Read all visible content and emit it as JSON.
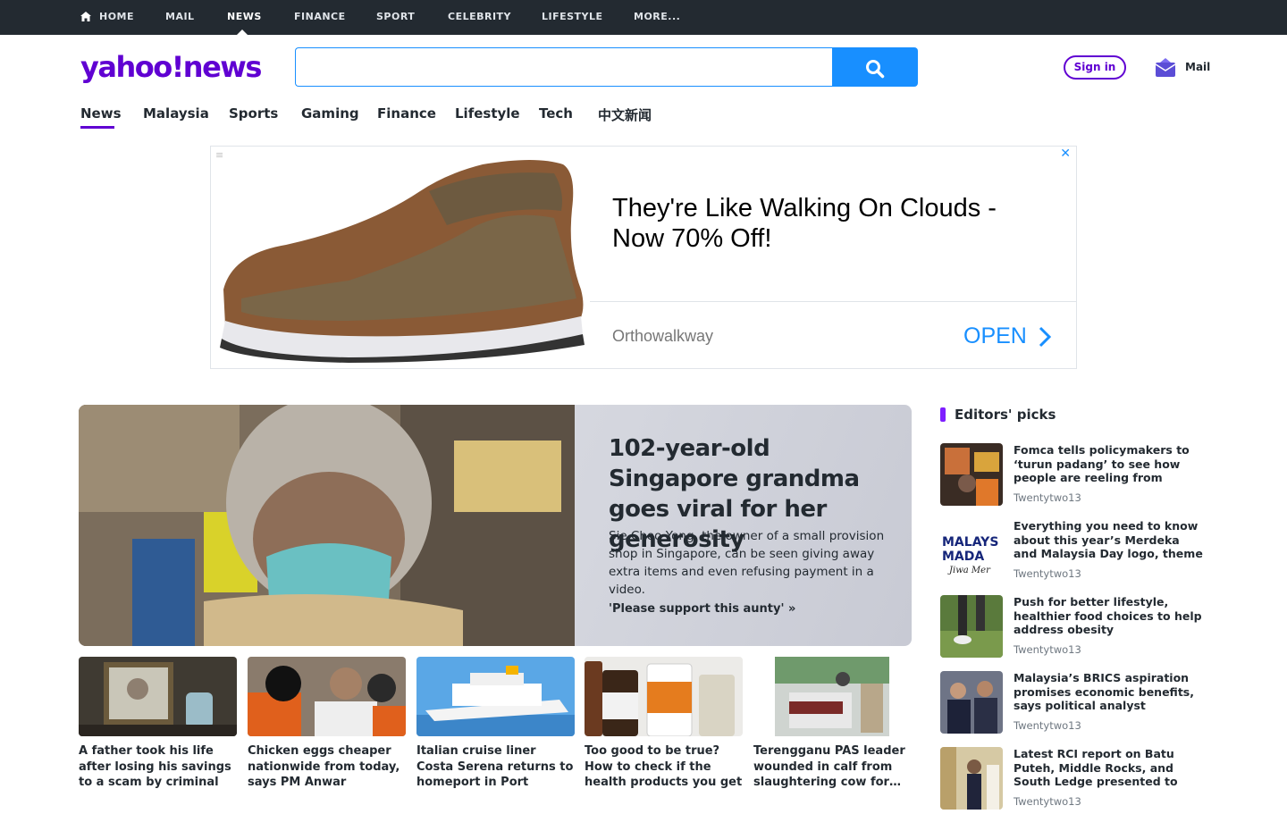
{
  "top_nav": {
    "items": [
      "Home",
      "Mail",
      "News",
      "Finance",
      "Sport",
      "Celebrity",
      "Lifestyle",
      "More..."
    ],
    "active": "News"
  },
  "header": {
    "logo_main": "yahoo!",
    "logo_section": "news",
    "search": {
      "value": "",
      "placeholder": ""
    },
    "signin_label": "Sign in",
    "mail_label": "Mail"
  },
  "sub_nav": {
    "items": [
      "News",
      "Malaysia",
      "Sports",
      "Gaming",
      "Finance",
      "Lifestyle",
      "Tech",
      "中文新闻"
    ],
    "active": "News"
  },
  "ad": {
    "headline": "They're Like Walking On Clouds - Now 70% Off!",
    "brand": "Orthowalkway",
    "cta": "OPEN"
  },
  "hero": {
    "title": "102-year-old Singapore grandma goes viral for her generosity",
    "summary": "Sie Choo Yong, the owner of a small provision shop in Singapore, can be seen giving away extra items and even refusing payment in a video.",
    "link": "'Please support this aunty' »"
  },
  "cards": [
    {
      "title": "A father took his life after losing his savings to a scam by criminal gangs"
    },
    {
      "title": "Chicken eggs cheaper nationwide from today, says PM Anwar"
    },
    {
      "title": "Italian cruise liner Costa Serena returns to homeport in Port Klang…"
    },
    {
      "title": "Too good to be true? How to check if the health products you get online…"
    },
    {
      "title": "Terengganu PAS leader wounded in calf from slaughtering cow for…"
    }
  ],
  "editors_picks": {
    "heading": "Editors' picks",
    "items": [
      {
        "title": "Fomca tells policymakers to ‘turun padang’ to see how people are reeling from rising…",
        "source": "Twentytwo13"
      },
      {
        "title": "Everything you need to know about this year’s Merdeka and Malaysia Day logo, theme",
        "source": "Twentytwo13"
      },
      {
        "title": "Push for better lifestyle, healthier food choices to help address obesity",
        "source": "Twentytwo13"
      },
      {
        "title": "Malaysia’s BRICS aspiration promises economic benefits, says political analyst",
        "source": "Twentytwo13"
      },
      {
        "title": "Latest RCI report on Batu Puteh, Middle Rocks, and South Ledge presented to Malaysia’s King",
        "source": "Twentytwo13"
      }
    ]
  },
  "colors": {
    "brand_purple": "#6001d2",
    "search_blue": "#188fff",
    "topnav_bg": "#232a31"
  }
}
